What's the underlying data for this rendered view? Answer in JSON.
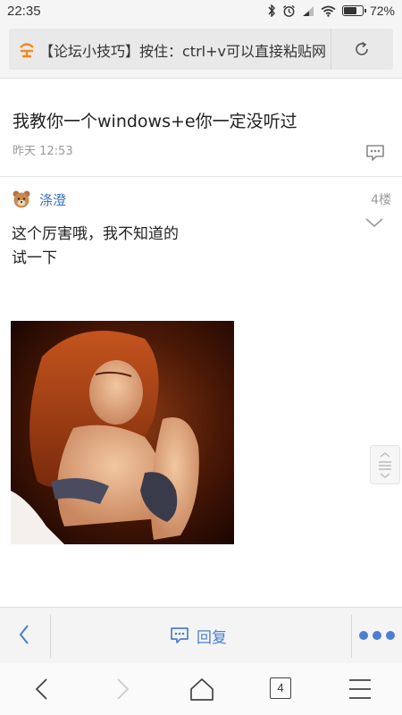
{
  "status_bar": {
    "time": "22:35",
    "battery_percent": "72%",
    "battery_level": 0.72
  },
  "url_bar": {
    "text": "【论坛小技巧】按住：ctrl+v可以直接粘贴网",
    "favicon": "forum-logo-icon",
    "accent_color": "#f08a24"
  },
  "post": {
    "title": "我教你一个windows+e你一定没听过",
    "time": "昨天 12:53"
  },
  "reply": {
    "username": "涤澄",
    "floor": "4楼",
    "lines": [
      "这个厉害哦，我不知道的",
      "试一下"
    ]
  },
  "action_bar": {
    "reply_label": "回复",
    "accent_color": "#4a7fd0"
  },
  "nav_bar": {
    "tab_count": "4"
  }
}
